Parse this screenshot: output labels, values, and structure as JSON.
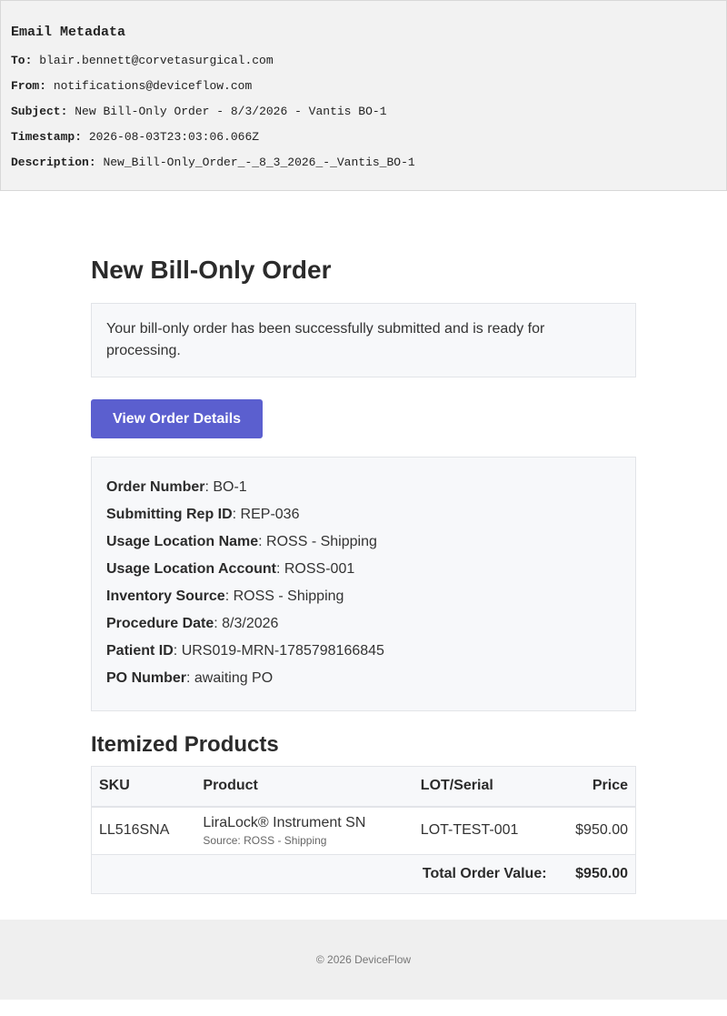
{
  "metadata": {
    "heading": "Email Metadata",
    "to_label": "To:",
    "to": "blair.bennett@corvetasurgical.com",
    "from_label": "From:",
    "from": "notifications@deviceflow.com",
    "subject_label": "Subject:",
    "subject": "New Bill-Only Order - 8/3/2026 - Vantis BO-1",
    "timestamp_label": "Timestamp:",
    "timestamp": "2026-08-03T23:03:06.066Z",
    "description_label": "Description:",
    "description": "New_Bill-Only_Order_-_8_3_2026_-_Vantis_BO-1"
  },
  "email": {
    "title": "New Bill-Only Order",
    "notice": "Your bill-only order has been successfully submitted and is ready for processing.",
    "button_label": "View Order Details",
    "details": [
      {
        "label": "Order Number",
        "value": ": BO-1"
      },
      {
        "label": "Submitting Rep ID",
        "value": ": REP-036"
      },
      {
        "label": "Usage Location Name",
        "value": ": ROSS - Shipping"
      },
      {
        "label": "Usage Location Account",
        "value": ": ROSS-001"
      },
      {
        "label": "Inventory Source",
        "value": ": ROSS - Shipping"
      },
      {
        "label": "Procedure Date",
        "value": ": 8/3/2026"
      },
      {
        "label": "Patient ID",
        "value": ": URS019-MRN-1785798166845"
      },
      {
        "label": "PO Number",
        "value": ": awaiting PO"
      }
    ],
    "products_heading": "Itemized Products",
    "table": {
      "headers": {
        "sku": "SKU",
        "product": "Product",
        "lot": "LOT/Serial",
        "price": "Price"
      },
      "rows": [
        {
          "sku": "LL516SNA",
          "product": "LiraLock® Instrument SN",
          "source": "Source: ROSS - Shipping",
          "lot": "LOT-TEST-001",
          "price": "$950.00"
        }
      ],
      "total_label": "Total Order Value:",
      "total_value": "$950.00"
    },
    "footer": "© 2026 DeviceFlow"
  },
  "colors": {
    "button": "#5b5fcf",
    "panel": "#f7f8fa",
    "metadata_bg": "#f2f2f2"
  }
}
